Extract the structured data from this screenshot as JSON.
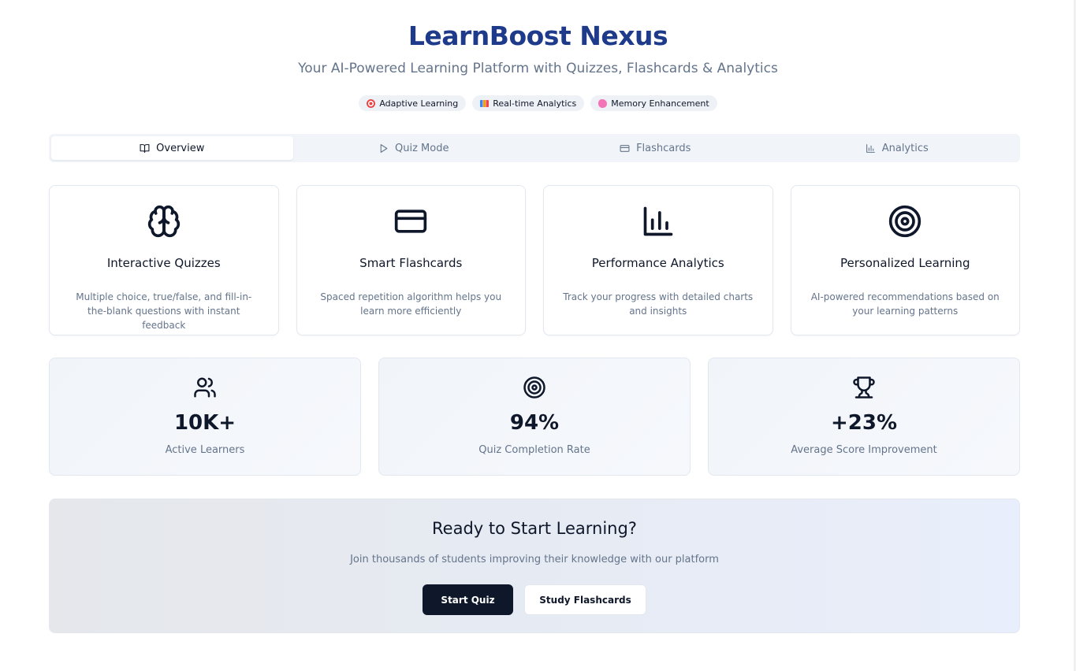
{
  "header": {
    "title": "LearnBoost Nexus",
    "subtitle": "Your AI-Powered Learning Platform with Quizzes, Flashcards & Analytics",
    "badges": [
      {
        "label": "Adaptive Learning",
        "icon": "target-icon"
      },
      {
        "label": "Real-time Analytics",
        "icon": "bar-chart-emoji-icon"
      },
      {
        "label": "Memory Enhancement",
        "icon": "brain-emoji-icon"
      }
    ]
  },
  "tabs": [
    {
      "label": "Overview",
      "icon": "book-open-icon",
      "active": true
    },
    {
      "label": "Quiz Mode",
      "icon": "play-icon",
      "active": false
    },
    {
      "label": "Flashcards",
      "icon": "credit-card-icon",
      "active": false
    },
    {
      "label": "Analytics",
      "icon": "bar-chart-icon",
      "active": false
    }
  ],
  "features": [
    {
      "title": "Interactive Quizzes",
      "description": "Multiple choice, true/false, and fill-in-the-blank questions with instant feedback",
      "icon": "brain-icon"
    },
    {
      "title": "Smart Flashcards",
      "description": "Spaced repetition algorithm helps you learn more efficiently",
      "icon": "credit-card-icon"
    },
    {
      "title": "Performance Analytics",
      "description": "Track your progress with detailed charts and insights",
      "icon": "bar-chart-icon"
    },
    {
      "title": "Personalized Learning",
      "description": "AI-powered recommendations based on your learning patterns",
      "icon": "target-icon"
    }
  ],
  "stats": [
    {
      "value": "10K+",
      "label": "Active Learners",
      "icon": "users-icon"
    },
    {
      "value": "94%",
      "label": "Quiz Completion Rate",
      "icon": "target-icon"
    },
    {
      "value": "+23%",
      "label": "Average Score Improvement",
      "icon": "trophy-icon"
    }
  ],
  "cta": {
    "title": "Ready to Start Learning?",
    "description": "Join thousands of students improving their knowledge with our platform",
    "primary_button": "Start Quiz",
    "secondary_button": "Study Flashcards"
  },
  "colors": {
    "brand": "#1e3a8a",
    "primary_button": "#0f172a",
    "muted_text": "#64748b",
    "border": "#e2e8f0"
  }
}
